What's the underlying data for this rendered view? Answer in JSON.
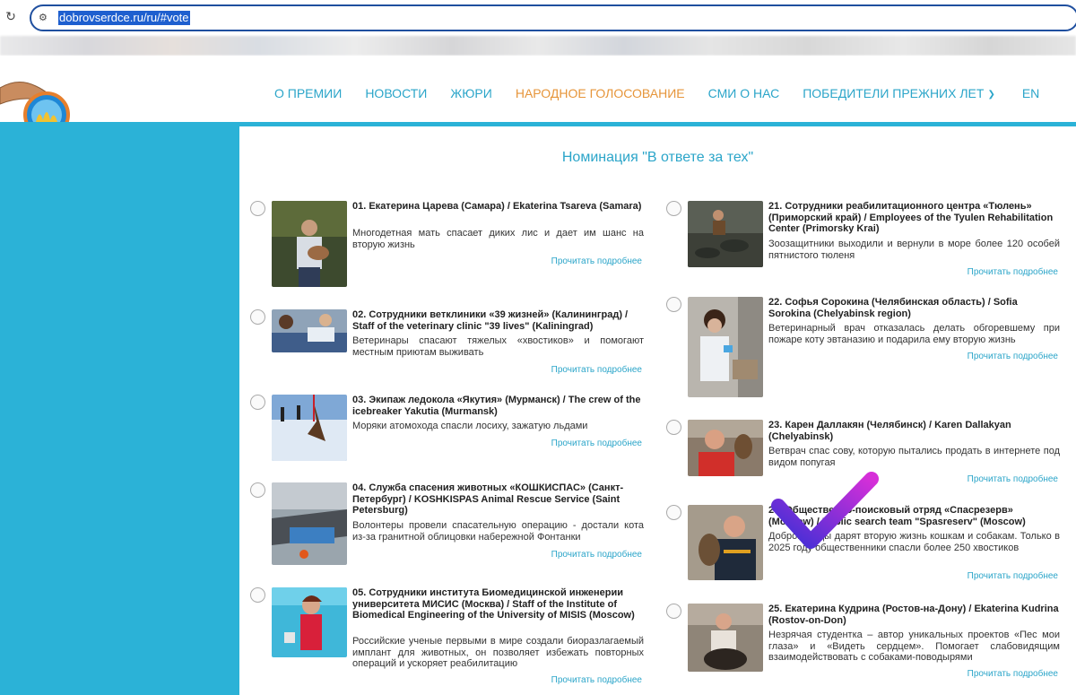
{
  "browser": {
    "url": "dobrovserdce.ru/ru/#vote"
  },
  "nav": {
    "items": [
      "О ПРЕМИИ",
      "НОВОСТИ",
      "ЖЮРИ",
      "НАРОДНОЕ ГОЛОСОВАНИЕ",
      "СМИ О НАС",
      "ПОБЕДИТЕЛИ ПРЕЖНИХ ЛЕТ"
    ],
    "active_index": 3,
    "lang": "EN"
  },
  "nomination": {
    "title": "Номинация \"В ответе за тех\""
  },
  "read_more_label": "Прочитать подробнее",
  "colors": {
    "accent_blue": "#2bb2d7",
    "nav_text": "#2ba5c9",
    "nav_active": "#e6953a",
    "checkmark_start": "#3b2fd6",
    "checkmark_end": "#d62fd8"
  },
  "nominees_left": [
    {
      "title": "01. Екатерина Царева (Самара) / Ekaterina Tsareva (Samara)",
      "desc": "Многодетная мать спасает диких лис и дает им шанс на вторую жизнь"
    },
    {
      "title": "02. Сотрудники ветклиники «39 жизней» (Калининград) / Staff of the veterinary clinic \"39 lives\" (Kaliningrad)",
      "desc": "Ветеринары спасают тяжелых «хвостиков» и помогают местным приютам выживать"
    },
    {
      "title": "03. Экипаж ледокола «Якутия» (Мурманск) / The crew of the icebreaker Yakutia (Murmansk)",
      "desc": "Моряки атомохода спасли лосиху, зажатую льдами"
    },
    {
      "title": "04. Служба спасения животных «КОШКИСПАС» (Санкт-Петербург) / KOSHKISPAS Animal Rescue Service (Saint Petersburg)",
      "desc": "Волонтеры провели спасательную операцию - достали кота из-за гранитной облицовки набережной Фонтанки"
    },
    {
      "title": "05. Сотрудники института Биомедицинской инженерии университета МИСИС (Москва) / Staff of the Institute of Biomedical Engineering of the University of MISIS (Moscow)",
      "desc": "Российские ученые первыми в мире создали биоразлагаемый имплант для животных, он позволяет избежать повторных операций и ускоряет реабилитацию"
    }
  ],
  "nominees_right": [
    {
      "title": "21. Сотрудники реабилитационного центра «Тюлень» (Приморский край) / Employees of the Tyulen Rehabilitation Center (Primorsky Krai)",
      "desc": "Зоозащитники выходили и вернули в море более 120 особей пятнистого тюленя"
    },
    {
      "title": "22. Софья Сорокина (Челябинская область) / Sofia Sorokina (Chelyabinsk region)",
      "desc": "Ветеринарный врач отказалась делать обгоревшему при пожаре коту эвтаназию и подарила ему вторую жизнь"
    },
    {
      "title": "23. Карен Даллакян (Челябинск) / Karen Dallakyan (Chelyabinsk)",
      "desc": "Ветврач спас сову, которую пытались продать в интернете под видом попугая"
    },
    {
      "title": "24. Общественно-поисковый отряд «Спасрезерв» (Moscow) / Public search team \"Spasreserv\" (Moscow)",
      "desc": "Добровольцы дарят вторую жизнь кошкам и собакам. Только в 2025 году общественники спасли более 250 хвостиков"
    },
    {
      "title": "25. Екатерина Кудрина (Ростов-на-Дону) / Ekaterina Kudrina (Rostov-on-Don)",
      "desc": "Незрячая студентка – автор уникальных проектов «Пес мои глаза» и «Видеть сердцем». Помогает слабовидящим взаимодействовать с собаками-поводырями"
    }
  ]
}
